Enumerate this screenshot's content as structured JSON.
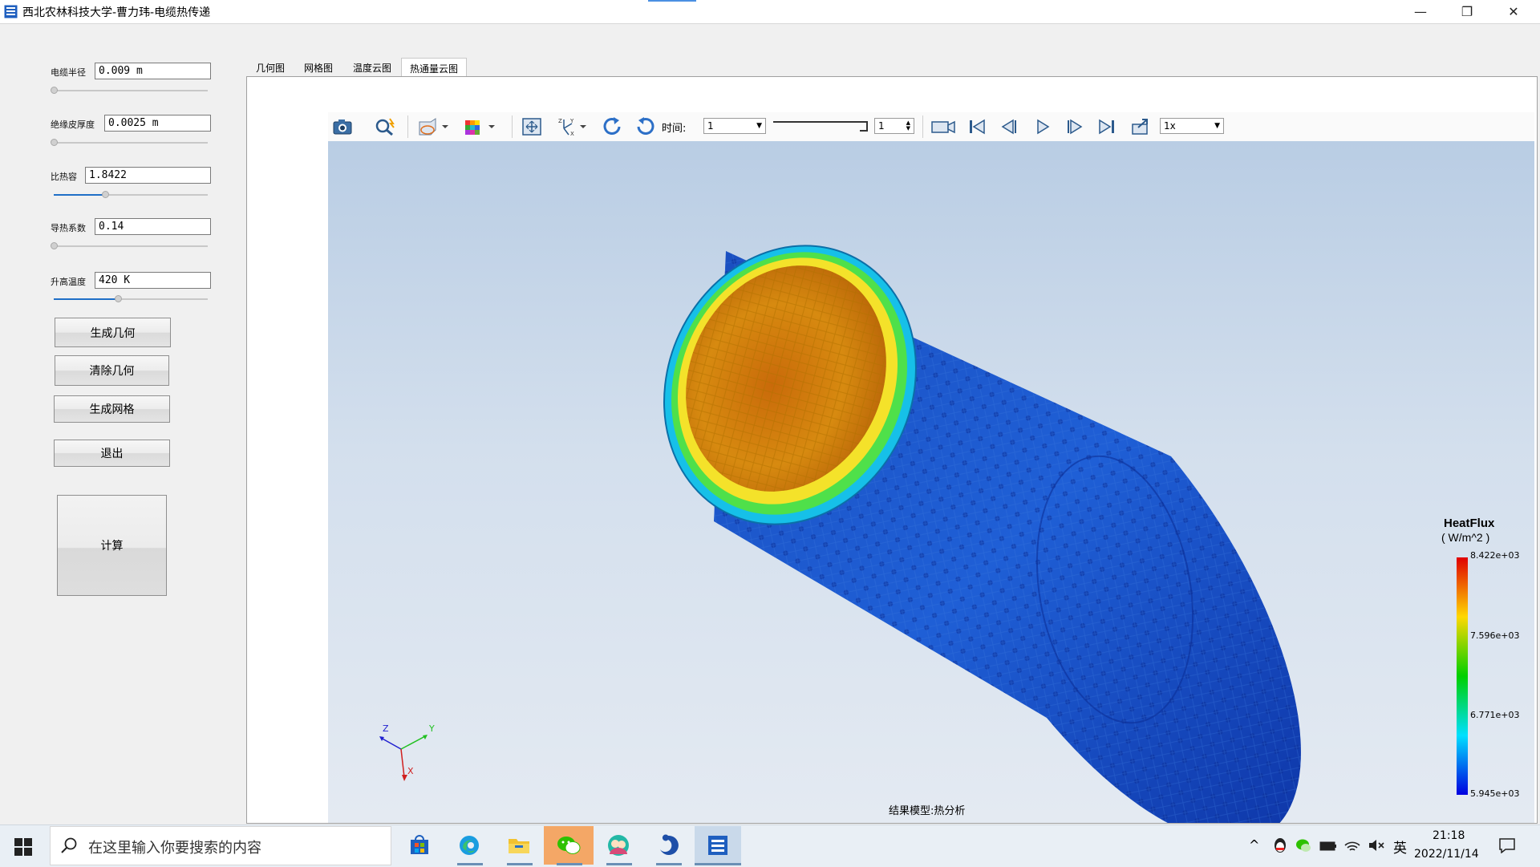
{
  "window": {
    "title": "西北农林科技大学-曹力玮-电缆热传递",
    "controls": {
      "minimize": "—",
      "restore": "❐",
      "close": "✕"
    }
  },
  "params": [
    {
      "label": "电缆半径",
      "value": "0.009 m",
      "slider_fraction": 0.0
    },
    {
      "label": "绝缘皮厚度",
      "value": "0.0025 m",
      "slider_fraction": 0.0
    },
    {
      "label": "比热容",
      "value": "1.8422",
      "slider_fraction": 0.33
    },
    {
      "label": "导热系数",
      "value": "0.14",
      "slider_fraction": 0.0
    },
    {
      "label": "升高温度",
      "value": "420 K",
      "slider_fraction": 0.42
    }
  ],
  "buttons": {
    "generate_geometry": "生成几何",
    "clear_geometry": "清除几何",
    "generate_mesh": "生成网格",
    "exit": "退出",
    "compute": "计算"
  },
  "tabs": [
    {
      "label": "几何图",
      "active": false
    },
    {
      "label": "网格图",
      "active": false
    },
    {
      "label": "温度云图",
      "active": false
    },
    {
      "label": "热通量云图",
      "active": true
    }
  ],
  "toolbar": {
    "time_label": "时间:",
    "time_value": "1",
    "step_value": "1",
    "speed_value": "1x",
    "icons": [
      "camera-icon",
      "zoom-icon",
      "display-mode-icon",
      "color-cube-icon",
      "fit-view-icon",
      "axes-icon",
      "rotate-cw-icon",
      "rotate-ccw-icon",
      "record-icon",
      "first-frame-icon",
      "prev-frame-icon",
      "play-icon",
      "next-frame-icon",
      "last-frame-icon",
      "export-icon"
    ]
  },
  "legend": {
    "title": "HeatFlux",
    "unit": "( W/m^2 )",
    "ticks": [
      "8.422e+03",
      "7.596e+03",
      "6.771e+03",
      "5.945e+03"
    ]
  },
  "axes_triad": {
    "z": "Z",
    "y": "Y",
    "x": "X"
  },
  "model_caption": "结果模型:热分析",
  "taskbar": {
    "search_placeholder": "在这里输入你要搜索的内容",
    "apps": [
      "store-icon",
      "edge-icon",
      "explorer-icon",
      "wechat-icon",
      "contacts-icon",
      "swirl-app-icon",
      "cable-app-icon"
    ],
    "tray": {
      "caret": "^",
      "ime": "英",
      "time": "21:18",
      "date": "2022/11/14"
    }
  },
  "colors": {
    "accent": "#1f6fc7",
    "legend_top": "#e00000",
    "legend_bottom": "#0000e0"
  }
}
